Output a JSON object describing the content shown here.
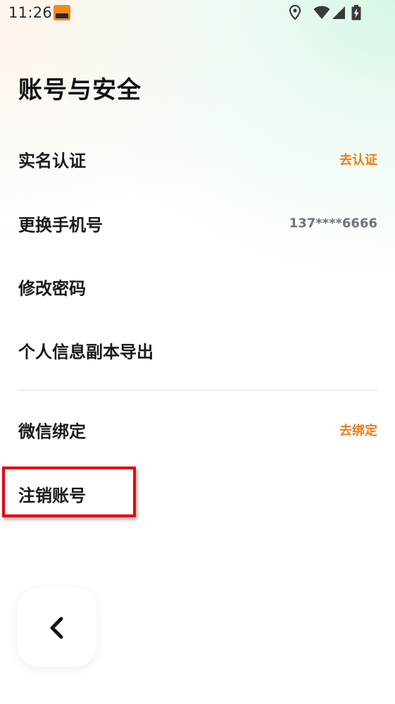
{
  "status_bar": {
    "time": "11:26",
    "icons": [
      "app-notification-icon",
      "location-icon",
      "wifi-icon",
      "signal-icon",
      "battery-charging-icon"
    ]
  },
  "page": {
    "title": "账号与安全"
  },
  "rows": [
    {
      "label": "实名认证",
      "value": "去认证"
    },
    {
      "label": "更换手机号",
      "value": "137****6666"
    },
    {
      "label": "修改密码",
      "value": ""
    },
    {
      "label": "个人信息副本导出",
      "value": ""
    },
    {
      "label": "微信绑定",
      "value": "去绑定"
    },
    {
      "label": "注销账号",
      "value": ""
    }
  ],
  "back_button": {
    "icon": "chevron-left-icon"
  },
  "colors": {
    "accent": "#f07d14",
    "highlight": "#e60012",
    "muted_text": "#6f7378"
  }
}
